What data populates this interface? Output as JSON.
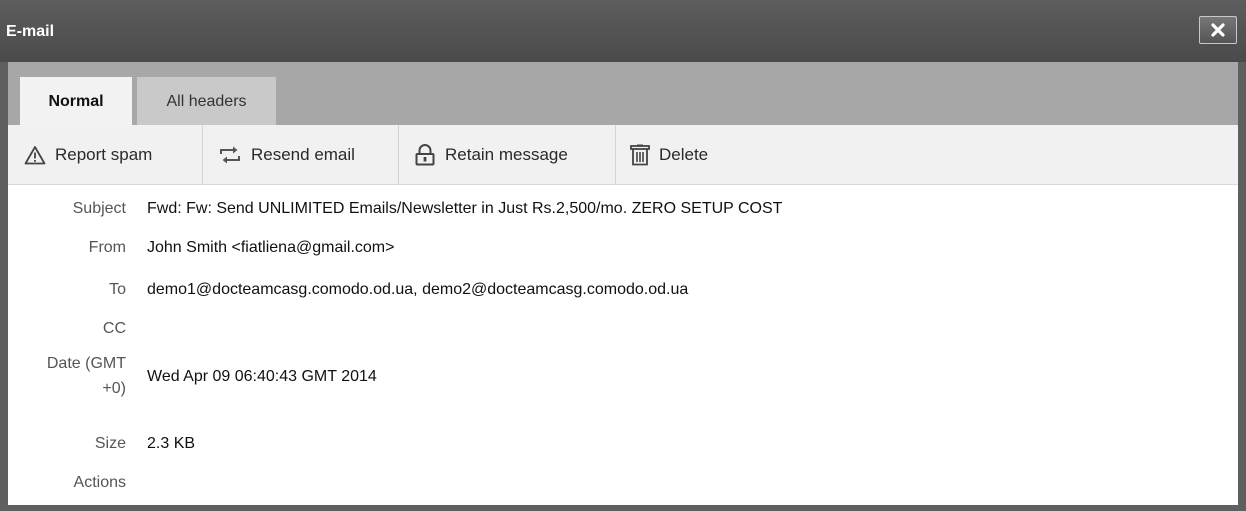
{
  "window": {
    "title": "E-mail"
  },
  "tabs": [
    {
      "label": "Normal",
      "active": true
    },
    {
      "label": "All headers",
      "active": false
    }
  ],
  "toolbar": {
    "report_spam": "Report spam",
    "resend_email": "Resend email",
    "retain_message": "Retain message",
    "delete": "Delete"
  },
  "fields": {
    "subject": {
      "label": "Subject",
      "value": "Fwd: Fw: Send UNLIMITED Emails/Newsletter in Just Rs.2,500/mo. ZERO SETUP COST"
    },
    "from": {
      "label": "From",
      "value": "John Smith <fiatliena@gmail.com>"
    },
    "to": {
      "label": "To",
      "value": "demo1@docteamcasg.comodo.od.ua, demo2@docteamcasg.comodo.od.ua"
    },
    "cc": {
      "label": "CC",
      "value": ""
    },
    "date": {
      "label_line1": "Date (GMT",
      "label_line2": "+0)",
      "value": "Wed Apr 09 06:40:43 GMT 2014"
    },
    "size": {
      "label": "Size",
      "value": "2.3 KB"
    },
    "actions": {
      "label": "Actions",
      "value": ""
    }
  },
  "colors": {
    "titlebar": "#4f4f4f",
    "tabbar": "#a7a7a7",
    "toolbar": "#f1f1f1"
  }
}
